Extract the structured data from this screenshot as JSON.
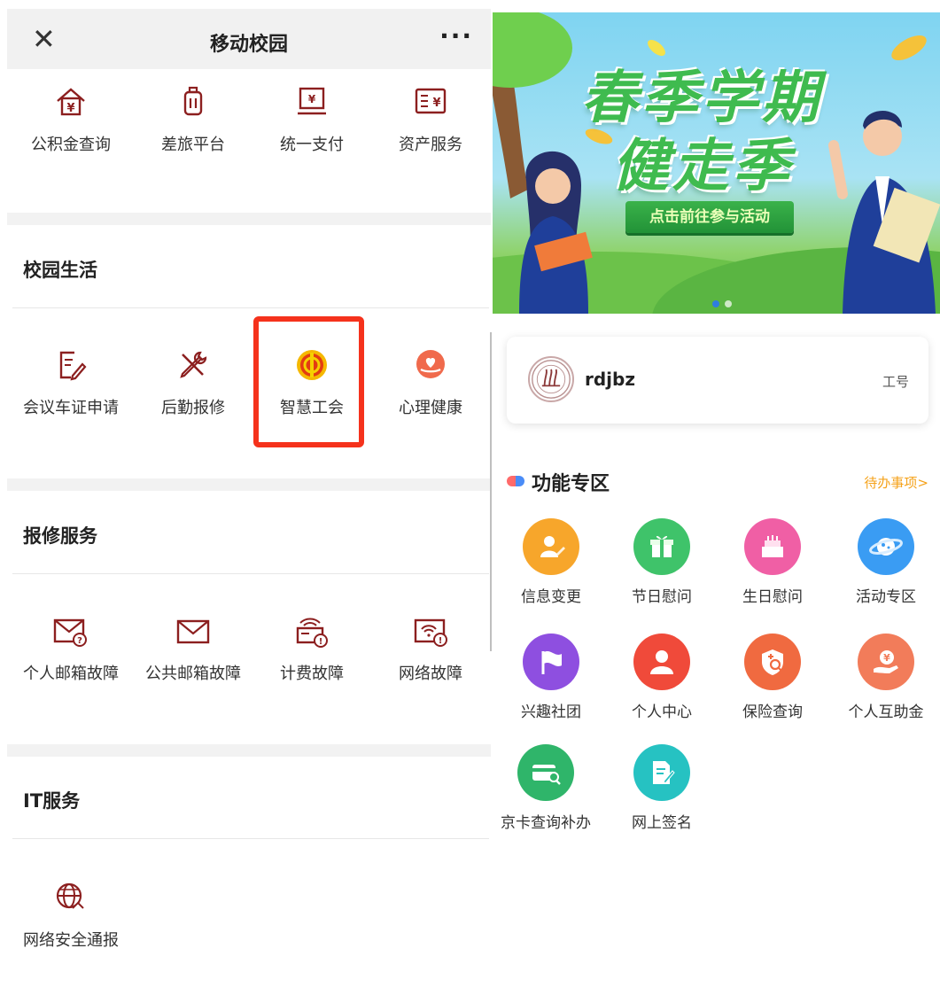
{
  "header": {
    "close": "✕",
    "title": "移动校园",
    "more": "···"
  },
  "top_row": [
    {
      "label": "公积金查询",
      "icon": "house-yen-icon"
    },
    {
      "label": "差旅平台",
      "icon": "luggage-icon"
    },
    {
      "label": "统一支付",
      "icon": "payment-terminal-icon"
    },
    {
      "label": "资产服务",
      "icon": "asset-ledger-icon"
    }
  ],
  "campus_life": {
    "title": "校园生活",
    "items": [
      {
        "label": "会议车证申请",
        "icon": "edit-document-icon"
      },
      {
        "label": "后勤报修",
        "icon": "wrench-screwdriver-icon"
      },
      {
        "label": "智慧工会",
        "icon": "trade-union-emblem-icon"
      },
      {
        "label": "心理健康",
        "icon": "heart-hand-icon"
      }
    ]
  },
  "repair_services": {
    "title": "报修服务",
    "items": [
      {
        "label": "个人邮箱故障",
        "icon": "mail-warning-icon"
      },
      {
        "label": "公共邮箱故障",
        "icon": "mail-icon"
      },
      {
        "label": "计费故障",
        "icon": "billing-warning-icon"
      },
      {
        "label": "网络故障",
        "icon": "wifi-warning-icon"
      }
    ]
  },
  "it_services": {
    "title": "IT服务",
    "items": [
      {
        "label": "网络安全通报",
        "icon": "globe-alert-icon"
      }
    ]
  },
  "banner": {
    "line1": "春季学期",
    "line2": "健走季",
    "cta": "点击前往参与活动",
    "slide_count": 2,
    "active_slide": 1
  },
  "profile": {
    "name": "rdjbz",
    "id_label": "工号"
  },
  "feature_zone": {
    "title": "功能专区",
    "link": "待办事项>",
    "items": [
      {
        "label": "信息变更",
        "icon": "edit-person-icon",
        "color": "#f7a62b"
      },
      {
        "label": "节日慰问",
        "icon": "gift-icon",
        "color": "#3fc36a"
      },
      {
        "label": "生日慰问",
        "icon": "birthday-cake-icon",
        "color": "#f05fa5"
      },
      {
        "label": "活动专区",
        "icon": "planet-icon",
        "color": "#3a9cf3"
      },
      {
        "label": "兴趣社团",
        "icon": "flag-icon",
        "color": "#8e4fe0"
      },
      {
        "label": "个人中心",
        "icon": "person-icon",
        "color": "#f04a3a"
      },
      {
        "label": "保险查询",
        "icon": "shield-search-icon",
        "color": "#f06a40"
      },
      {
        "label": "个人互助金",
        "icon": "hand-coin-icon",
        "color": "#f27c5a"
      },
      {
        "label": "京卡查询补办",
        "icon": "card-search-icon",
        "color": "#2fb56a"
      },
      {
        "label": "网上签名",
        "icon": "document-sign-icon",
        "color": "#26c2c2"
      }
    ]
  }
}
